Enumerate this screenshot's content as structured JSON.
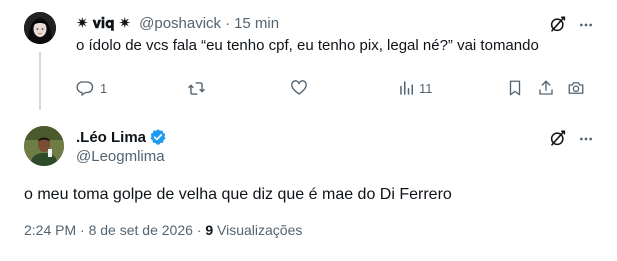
{
  "reply": {
    "display_name": "✷ 𝐯𝐢𝐪 ✷",
    "handle": "@poshavick",
    "separator": "·",
    "time": "15 min",
    "text": "o ídolo de vcs fala “eu tenho cpf, eu tenho pix, legal né?” vai tomando",
    "actions": {
      "reply_count": "1",
      "retweet_count": "",
      "like_count": "",
      "views_count": "11"
    }
  },
  "main_tweet": {
    "display_name": ".Léo Lima",
    "handle": "@Leogmlima",
    "text": "o meu toma golpe de velha que diz que é mae do Di Ferrero",
    "timestamp": "2:24 PM · 8 de set de 2026 · ",
    "views_count": "9",
    "views_label": " Visualizações"
  },
  "colors": {
    "accent": "#1d9bf0",
    "muted": "#536471",
    "text": "#0f1419",
    "thread_line": "#cfd9de"
  }
}
